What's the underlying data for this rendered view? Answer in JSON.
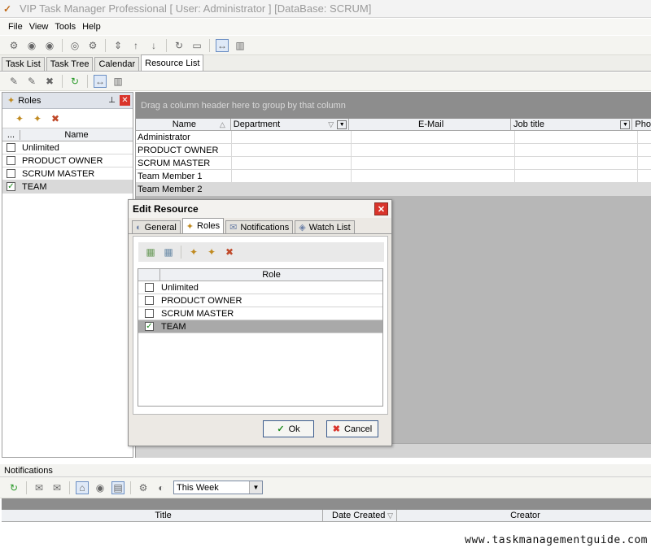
{
  "window": {
    "title": "VIP Task Manager Professional [ User: Administrator ] [DataBase: SCRUM]"
  },
  "menu": [
    "File",
    "View",
    "Tools",
    "Help"
  ],
  "main_tabs": [
    {
      "label": "Task List",
      "active": false
    },
    {
      "label": "Task Tree",
      "active": false
    },
    {
      "label": "Calendar",
      "active": false
    },
    {
      "label": "Resource List",
      "active": true
    }
  ],
  "roles_panel": {
    "title": "Roles",
    "column": "Name",
    "ellipsis": "...",
    "items": [
      {
        "name": "Unlimited",
        "checked": false
      },
      {
        "name": "PRODUCT OWNER",
        "checked": false
      },
      {
        "name": "SCRUM MASTER",
        "checked": false
      },
      {
        "name": "TEAM",
        "checked": true
      }
    ]
  },
  "resource_grid": {
    "group_hint": "Drag a column header here to group by that column",
    "columns": [
      "Name",
      "Department",
      "E-Mail",
      "Job title",
      "Pho"
    ],
    "rows": [
      "Administrator",
      "PRODUCT OWNER",
      "SCRUM MASTER",
      "Team Member 1",
      "Team Member 2"
    ]
  },
  "dialog": {
    "title": "Edit Resource",
    "tabs": [
      {
        "label": "General",
        "active": false
      },
      {
        "label": "Roles",
        "active": true
      },
      {
        "label": "Notifications",
        "active": false
      },
      {
        "label": "Watch List",
        "active": false
      }
    ],
    "role_column": "Role",
    "roles": [
      {
        "name": "Unlimited",
        "checked": false
      },
      {
        "name": "PRODUCT OWNER",
        "checked": false
      },
      {
        "name": "SCRUM MASTER",
        "checked": false
      },
      {
        "name": "TEAM",
        "checked": true
      }
    ],
    "ok_label": "Ok",
    "cancel_label": "Cancel"
  },
  "notifications": {
    "title": "Notifications",
    "period": "This Week",
    "columns": [
      "Title",
      "Date Created",
      "Creator"
    ]
  },
  "watermark": "www.taskmanagementguide.com",
  "colors": {
    "close_red": "#d9342b",
    "check_green": "#1a8a1a",
    "group_bar": "#8d8d8d"
  }
}
